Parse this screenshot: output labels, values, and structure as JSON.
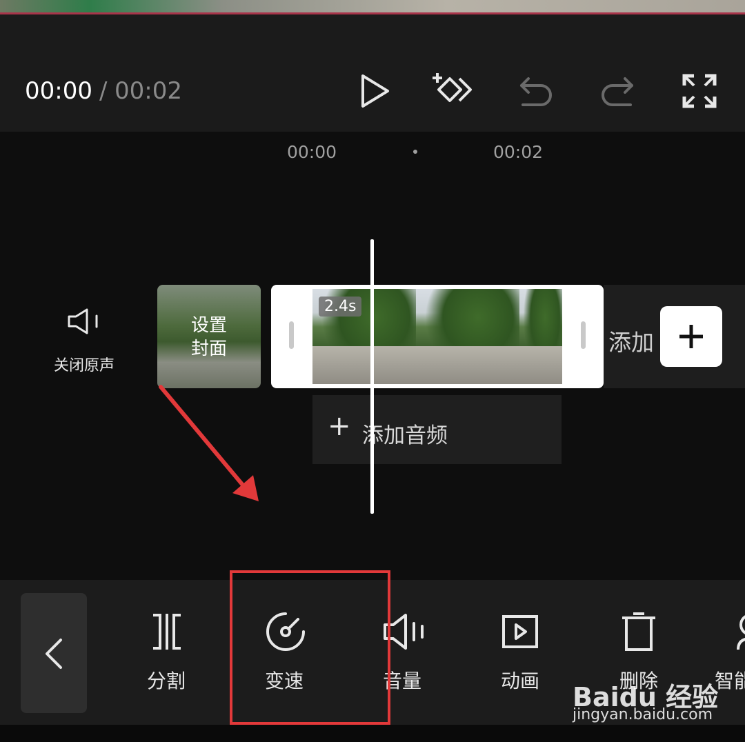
{
  "playback": {
    "current_time": "00:00",
    "separator": "/",
    "total_time": "00:02"
  },
  "ruler": {
    "ticks": [
      "00:00",
      "00:02"
    ]
  },
  "track": {
    "mute_label": "关闭原声",
    "cover_label_line1": "设置",
    "cover_label_line2": "封面",
    "clip_duration": "2.4s",
    "add_clip_label": "添加",
    "add_audio_label": "添加音频"
  },
  "toolbar": {
    "items": [
      {
        "label": "分割",
        "icon": "split-icon"
      },
      {
        "label": "变速",
        "icon": "speed-icon"
      },
      {
        "label": "音量",
        "icon": "volume-icon"
      },
      {
        "label": "动画",
        "icon": "animation-icon"
      },
      {
        "label": "删除",
        "icon": "delete-icon"
      },
      {
        "label": "智能",
        "icon": "smart-icon"
      }
    ]
  },
  "watermark": {
    "brand": "Baidu 经验",
    "url": "jingyan.baidu.com"
  },
  "colors": {
    "accent_red": "#e2393a",
    "background": "#0e0e0e",
    "toolbar": "#1c1c1c"
  }
}
